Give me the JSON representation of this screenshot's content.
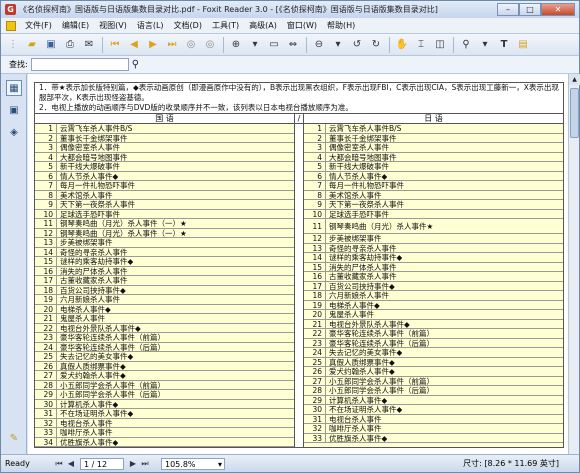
{
  "window": {
    "title": "《名侦探柯南》国语版与日语版集数目录对比.pdf - Foxit Reader 3.0 - [《名侦探柯南》国语版与日语版集数目录对比]"
  },
  "menu": [
    "文件(F)",
    "编辑(E)",
    "视图(V)",
    "语言(L)",
    "文档(D)",
    "工具(T)",
    "高级(A)",
    "窗口(W)",
    "帮助(H)"
  ],
  "search": {
    "label": "查找:"
  },
  "document": {
    "notes": [
      "1．带★表示加长版特别篇，◆表示动画原创（即漫画原作中没有的），B表示出现黑衣组织，F表示出现FBI，C表示出现CIA，S表示出现工藤新一，X表示出现服部平次，K表示出现怪盗基德。",
      "2．电视上播放的动画顺序与DVD版的收录顺序并不一致，该列表以日本电视台播放顺序为准。"
    ],
    "left_header": "国 语",
    "divider": "/",
    "right_header": "日 语",
    "left_rows": [
      [
        "1",
        "云霄飞车杀人事件B/S"
      ],
      [
        "2",
        "董事长千金绑架事件"
      ],
      [
        "3",
        "偶像密室杀人事件"
      ],
      [
        "4",
        "大都会暗号地图事件"
      ],
      [
        "5",
        "新干线大爆破事件"
      ],
      [
        "6",
        "情人节杀人事件◆"
      ],
      [
        "7",
        "每月一件礼物恐吓事件"
      ],
      [
        "8",
        "美术馆杀人事件"
      ],
      [
        "9",
        "天下第一夜祭杀人事件"
      ],
      [
        "10",
        "足球选手恐吓事件"
      ],
      [
        "11",
        "钢琴奏鸣曲（月光）杀人事件（一）★"
      ],
      [
        "12",
        "钢琴奏鸣曲（月光）杀人事件（一）★"
      ],
      [
        "13",
        "步美被绑架事件"
      ],
      [
        "14",
        "奇怪的寻亲杀人事件"
      ],
      [
        "15",
        "谜样的乘客劫持事件◆"
      ],
      [
        "16",
        "消失的尸体杀人事件"
      ],
      [
        "17",
        "古董收藏家杀人事件"
      ],
      [
        "18",
        "百货公司挟持事件◆"
      ],
      [
        "19",
        "六月新娘杀人事件"
      ],
      [
        "20",
        "电梯杀人事件◆"
      ],
      [
        "21",
        "鬼屋杀人事件"
      ],
      [
        "22",
        "电视台外景队杀人事件◆"
      ],
      [
        "23",
        "豪华客轮连续杀人事件（前篇）"
      ],
      [
        "24",
        "豪华客轮连续杀人事件（后篇）"
      ],
      [
        "25",
        "失去记忆的美女事件◆"
      ],
      [
        "26",
        "真假人质绑票事件◆"
      ],
      [
        "27",
        "爱犬约翰杀人事件◆"
      ],
      [
        "28",
        "小五郎同学会杀人事件（前篇）"
      ],
      [
        "29",
        "小五郎同学会杀人事件（后篇）"
      ],
      [
        "30",
        "计算机杀人事件◆"
      ],
      [
        "31",
        "不在场证明杀人事件◆"
      ],
      [
        "32",
        "电视台杀人事件"
      ],
      [
        "33",
        "咖啡厅杀人事件"
      ],
      [
        "34",
        "优胜旗杀人事件◆"
      ]
    ],
    "right_rows": [
      [
        "1",
        "云霄飞车杀人事件B/S"
      ],
      [
        "2",
        "董事长千金绑架事件"
      ],
      [
        "3",
        "偶像密室杀人事件"
      ],
      [
        "4",
        "大都会暗号地图事件"
      ],
      [
        "5",
        "新干线大爆破事件"
      ],
      [
        "6",
        "情人节杀人事件◆"
      ],
      [
        "7",
        "每月一件礼物恐吓事件"
      ],
      [
        "8",
        "美术馆杀人事件"
      ],
      [
        "9",
        "天下第一夜祭杀人事件"
      ],
      [
        "10",
        "足球选手恐吓事件"
      ],
      [
        "11",
        "钢琴奏鸣曲（月光）杀人事件★"
      ],
      [
        "12",
        "步美被绑架事件"
      ],
      [
        "13",
        "奇怪的寻亲杀人事件"
      ],
      [
        "14",
        "谜样的乘客劫持事件◆"
      ],
      [
        "15",
        "消失的尸体杀人事件"
      ],
      [
        "16",
        "古董收藏家杀人事件"
      ],
      [
        "17",
        "百货公司挟持事件◆"
      ],
      [
        "18",
        "六月新娘杀人事件"
      ],
      [
        "19",
        "电梯杀人事件◆"
      ],
      [
        "20",
        "鬼屋杀人事件"
      ],
      [
        "21",
        "电视台外景队杀人事件◆"
      ],
      [
        "22",
        "豪华客轮连续杀人事件（前篇）"
      ],
      [
        "23",
        "豪华客轮连续杀人事件（后篇）"
      ],
      [
        "24",
        "失去记忆的美女事件◆"
      ],
      [
        "25",
        "真假人质绑票事件◆"
      ],
      [
        "26",
        "爱犬约翰杀人事件◆"
      ],
      [
        "27",
        "小五郎同学会杀人事件（前篇）"
      ],
      [
        "28",
        "小五郎同学会杀人事件（后篇）"
      ],
      [
        "29",
        "计算机杀人事件◆"
      ],
      [
        "30",
        "不在场证明杀人事件◆"
      ],
      [
        "31",
        "电视台杀人事件"
      ],
      [
        "32",
        "咖啡厅杀人事件"
      ],
      [
        "33",
        "优胜旗杀人事件◆"
      ]
    ]
  },
  "status": {
    "ready": "Ready",
    "page": "1 / 12",
    "zoom": "105.8%",
    "size": "尺寸: [8.26 * 11.69 英寸]"
  },
  "colors": {
    "table_bg": "#ffffd4",
    "accent": "#c0392b"
  }
}
